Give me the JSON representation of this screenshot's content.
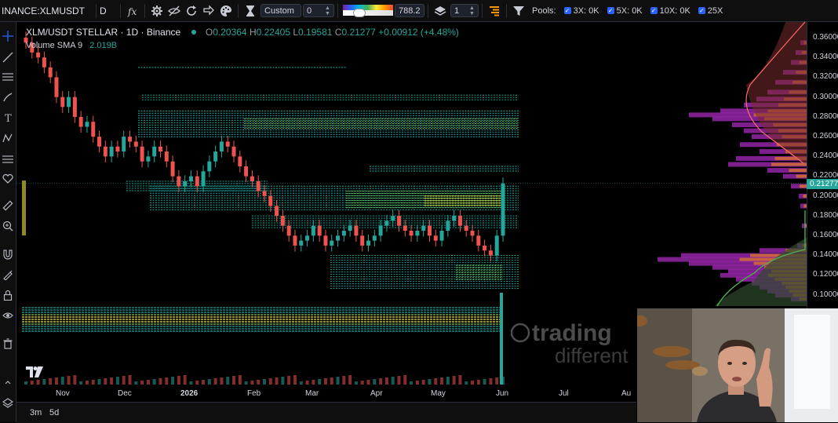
{
  "toolbar": {
    "symbol": "INANCE:XLMUSDT",
    "interval": "D",
    "custom_label": "Custom",
    "custom_value": "0",
    "opacity_value": "788.2",
    "layers_value": "1",
    "pools_label": "Pools:",
    "pools": [
      {
        "label": "3X: 0K"
      },
      {
        "label": "5X: 0K"
      },
      {
        "label": "10X: 0K"
      },
      {
        "label": "25X"
      }
    ]
  },
  "legend": {
    "title": "XLM/USDT STELLAR · 1D · Binance",
    "o_label": "O",
    "o_value": "0.20364",
    "h_label": "H",
    "h_value": "0.22405",
    "l_label": "L",
    "l_value": "0.19581",
    "c_label": "C",
    "c_value": "0.21277",
    "change": "+0.00912 (+4.48%)",
    "volume_label": "Volume SMA 9",
    "volume_value": "2.019B"
  },
  "price_scale": {
    "labels": [
      "0.36000",
      "0.34000",
      "0.32000",
      "0.30000",
      "0.28000",
      "0.26000",
      "0.24000",
      "0.22000",
      "0.20000",
      "0.18000",
      "0.16000",
      "0.14000",
      "0.12000",
      "0.10000"
    ],
    "current_price": "0.21277",
    "current_color": "#26a69a"
  },
  "time_scale": {
    "labels": [
      "Nov",
      "Dec",
      "2026",
      "Feb",
      "Mar",
      "Apr",
      "May",
      "Jun",
      "Jul",
      "Au"
    ]
  },
  "range_buttons": [
    "3m",
    "5d"
  ],
  "watermark": {
    "line1": "trading",
    "line2": "different"
  },
  "colors": {
    "up": "#26a69a",
    "down": "#ef5350",
    "heat_low": "#1fa39a",
    "heat_mid": "#7cc84a",
    "heat_high": "#f0e63a",
    "profile_purple": "#9c27b0",
    "profile_orange": "#ff9800"
  },
  "chart_data": {
    "type": "candlestick",
    "symbol": "XLM/USDT",
    "x_labels": [
      "Nov",
      "Dec",
      "2026",
      "Feb",
      "Mar",
      "Apr",
      "May",
      "Jun"
    ],
    "ylim": [
      0.09,
      0.37
    ],
    "closes": [
      0.355,
      0.345,
      0.34,
      0.33,
      0.32,
      0.3,
      0.29,
      0.3,
      0.28,
      0.27,
      0.275,
      0.26,
      0.25,
      0.24,
      0.25,
      0.245,
      0.26,
      0.255,
      0.25,
      0.235,
      0.24,
      0.25,
      0.245,
      0.235,
      0.22,
      0.21,
      0.215,
      0.22,
      0.21,
      0.225,
      0.235,
      0.245,
      0.255,
      0.25,
      0.24,
      0.23,
      0.22,
      0.215,
      0.205,
      0.2,
      0.19,
      0.18,
      0.17,
      0.16,
      0.15,
      0.155,
      0.16,
      0.17,
      0.16,
      0.15,
      0.155,
      0.16,
      0.165,
      0.17,
      0.16,
      0.15,
      0.155,
      0.16,
      0.17,
      0.175,
      0.18,
      0.17,
      0.165,
      0.16,
      0.165,
      0.17,
      0.16,
      0.155,
      0.165,
      0.175,
      0.18,
      0.17,
      0.165,
      0.16,
      0.15,
      0.145,
      0.14,
      0.16,
      0.21277
    ],
    "last": {
      "open": 0.20364,
      "high": 0.22405,
      "low": 0.19581,
      "close": 0.21277
    }
  }
}
